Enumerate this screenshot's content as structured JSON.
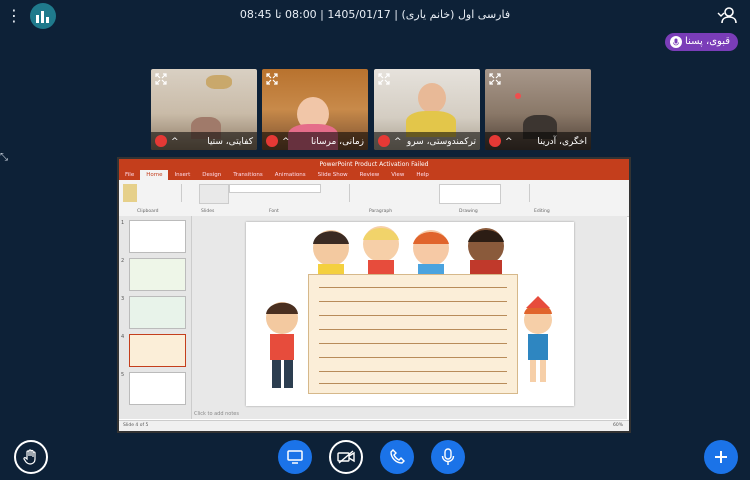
{
  "meeting": {
    "title": "فارسی اول (خانم یاری) | 1405/01/17 | 08:00 تا 08:45",
    "presenter_name": "قبوی، پسنا"
  },
  "participants": [
    {
      "name": "کفایتی، ستیا"
    },
    {
      "name": "زمانی، مرسانا"
    },
    {
      "name": "ترکمندوستی، سرو"
    },
    {
      "name": "اخگری، آدرینا"
    }
  ],
  "presentation": {
    "title_bar": "PowerPoint Product Activation Failed",
    "tabs": [
      "File",
      "Home",
      "Insert",
      "Design",
      "Transitions",
      "Animations",
      "Slide Show",
      "Review",
      "View",
      "Help"
    ],
    "active_tab": "Home",
    "ribbon_groups": [
      "Clipboard",
      "Slides",
      "Font",
      "Paragraph",
      "Drawing",
      "Editing"
    ],
    "notes_placeholder": "Click to add notes",
    "status_left": "Slide 4 of 5",
    "zoom": "60%",
    "thumbnails": [
      "1",
      "2",
      "3",
      "4",
      "5"
    ],
    "selected_slide": 4
  },
  "icons": {
    "menu": "vertical-dots-icon",
    "logo": "bars-logo-icon",
    "users": "users-icon",
    "raise_hand": "hand-icon",
    "screen_share": "screen-share-icon",
    "camera_off": "camera-off-icon",
    "phone": "phone-icon",
    "mic": "microphone-icon",
    "add": "plus-icon"
  },
  "colors": {
    "background": "#0d2137",
    "accent": "#1b73e8",
    "presenter_pill": "#7a3db8",
    "mute": "#e53935",
    "ppt": "#c43e1c"
  }
}
